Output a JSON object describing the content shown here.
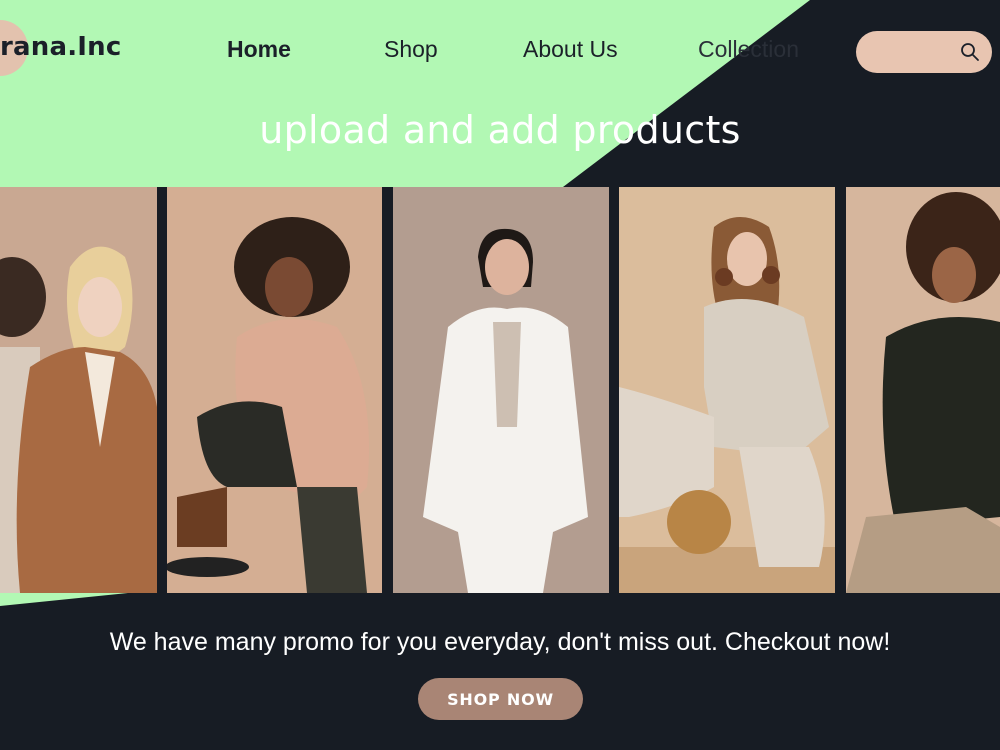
{
  "brand": {
    "logo_text": "rana.Inc"
  },
  "nav": {
    "items": [
      {
        "label": "Home",
        "active": true
      },
      {
        "label": "Shop",
        "active": false
      },
      {
        "label": "About Us",
        "active": false
      },
      {
        "label": "Collection",
        "active": false
      }
    ]
  },
  "search": {
    "placeholder": "",
    "value": "",
    "icon": "search-icon"
  },
  "hero": {
    "headline": "upload and add products"
  },
  "gallery": {
    "photos": [
      {
        "subject": "woman in camel coat"
      },
      {
        "subject": "woman in beige blazer with boots"
      },
      {
        "subject": "woman in white suit"
      },
      {
        "subject": "woman in knit set with basket bag"
      },
      {
        "subject": "woman in black jacket"
      }
    ]
  },
  "promo": {
    "text": "We have many promo for you everyday, don't miss out. Checkout now!",
    "button_label": "SHOP NOW"
  },
  "colors": {
    "green": "#b2f8b4",
    "dark": "#171c24",
    "accent": "#e8c5b1",
    "button": "#a98575"
  }
}
